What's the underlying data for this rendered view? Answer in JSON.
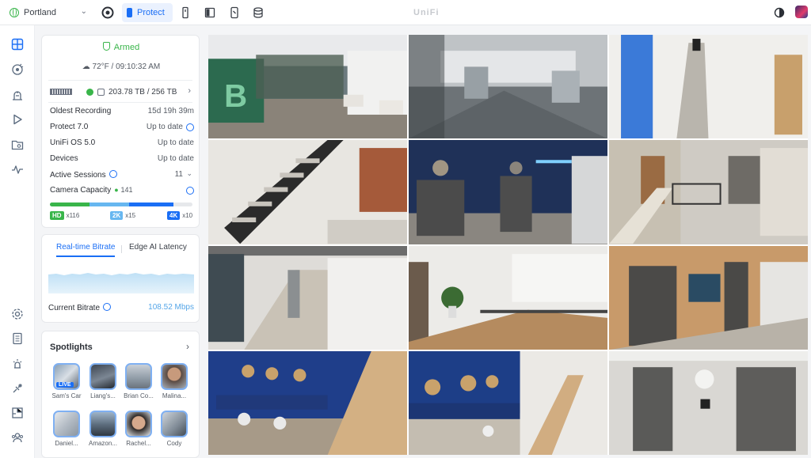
{
  "topbar": {
    "site_name": "Portland",
    "app_tab": "Protect",
    "brand": "UniFi",
    "icons": [
      "site-globe-icon",
      "protect-app-icon",
      "access-app-icon",
      "network-app-icon",
      "talk-app-icon",
      "storage-app-icon",
      "theme-toggle-icon",
      "user-avatar"
    ]
  },
  "status": {
    "armed_label": "Armed",
    "weather": "72°F / 09:10:32 AM",
    "storage": "203.78 TB / 256 TB",
    "oldest_recording_label": "Oldest Recording",
    "oldest_recording_value": "15d 19h 39m",
    "protect_label": "Protect 7.0",
    "protect_value": "Up to date",
    "os_label": "UniFi OS 5.0",
    "os_value": "Up to date",
    "devices_label": "Devices",
    "devices_value": "Up to date",
    "sessions_label": "Active Sessions",
    "sessions_value": "11",
    "capacity_label": "Camera Capacity",
    "capacity_value": "141",
    "capacity_split": {
      "hd": 116,
      "2k": 15,
      "4k": 10
    },
    "hd_tag": "HD",
    "hd_count": "x116",
    "k2_tag": "2K",
    "k2_count": "x15",
    "k4_tag": "4K",
    "k4_count": "x10"
  },
  "bitrate": {
    "tab_realtime": "Real-time Bitrate",
    "tab_edge": "Edge AI Latency",
    "current_label": "Current Bitrate",
    "current_value": "108.52 Mbps"
  },
  "spotlights": {
    "title": "Spotlights",
    "live_badge": "LIVE",
    "items": [
      {
        "label": "Sam's Car"
      },
      {
        "label": "Liang's..."
      },
      {
        "label": "Brian Co..."
      },
      {
        "label": "Malina..."
      },
      {
        "label": "Daniel..."
      },
      {
        "label": "Amazon..."
      },
      {
        "label": "Rachel..."
      },
      {
        "label": "Cody"
      }
    ]
  },
  "colors": {
    "accent": "#1a6ef5",
    "armed": "#39b54a",
    "hd": "#39b54a",
    "k2": "#67b7f0",
    "k4": "#1a6ef5"
  }
}
